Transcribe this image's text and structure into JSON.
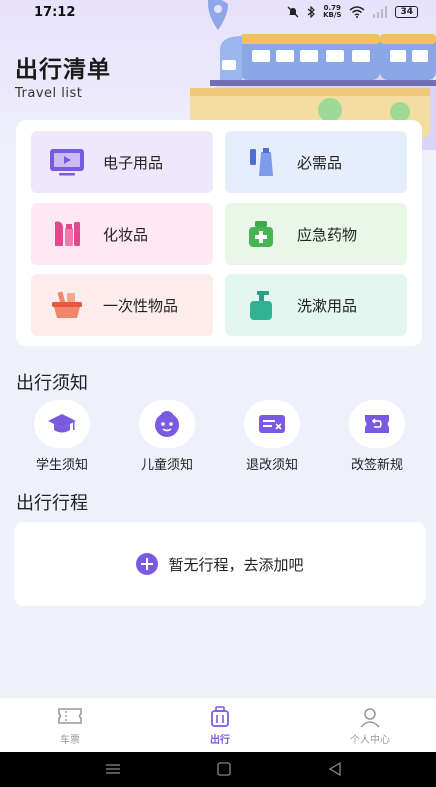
{
  "status_bar": {
    "time": "17:12",
    "net_speed_value": "0.79",
    "net_speed_unit": "KB/S",
    "battery": "34"
  },
  "header": {
    "title": "出行清单",
    "subtitle": "Travel list"
  },
  "categories": [
    {
      "label": "电子用品",
      "icon": "tv-icon",
      "bg": "#ede8fb"
    },
    {
      "label": "必需品",
      "icon": "toiletries-icon",
      "bg": "#e6edfb"
    },
    {
      "label": "化妆品",
      "icon": "cosmetics-icon",
      "bg": "#fde8f4"
    },
    {
      "label": "应急药物",
      "icon": "medicine-kit-icon",
      "bg": "#e8f7e8"
    },
    {
      "label": "一次性物品",
      "icon": "basket-icon",
      "bg": "#fdecec"
    },
    {
      "label": "洗漱用品",
      "icon": "soap-bottle-icon",
      "bg": "#e4f6f0"
    }
  ],
  "notice_section": {
    "title": "出行须知",
    "items": [
      {
        "label": "学生须知",
        "icon": "graduation-cap-icon"
      },
      {
        "label": "儿童须知",
        "icon": "child-face-icon"
      },
      {
        "label": "退改须知",
        "icon": "refund-ticket-icon"
      },
      {
        "label": "改签新规",
        "icon": "reschedule-ticket-icon"
      }
    ]
  },
  "trip_section": {
    "title": "出行行程",
    "empty_text": "暂无行程，去添加吧"
  },
  "tab_bar": {
    "tabs": [
      {
        "label": "车票",
        "icon": "ticket-icon",
        "active": false
      },
      {
        "label": "出行",
        "icon": "luggage-icon",
        "active": true
      },
      {
        "label": "个人中心",
        "icon": "person-icon",
        "active": false
      }
    ]
  },
  "colors": {
    "accent": "#7a5ae0",
    "background": "#eef0fb"
  }
}
